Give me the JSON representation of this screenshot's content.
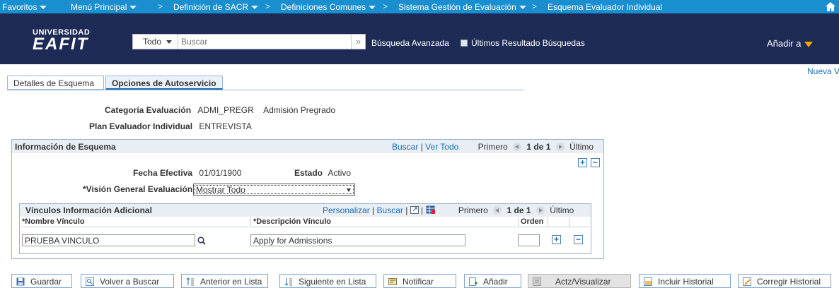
{
  "topnav": {
    "favorites": "Favoritos",
    "main_menu": "Menú Principal",
    "breadcrumbs": [
      "Definición de SACR",
      "Definiciones Comunes",
      "Sistema Gestión de Evaluación",
      "Esquema Evaluador Individual"
    ]
  },
  "header": {
    "logo_line1": "UNIVERSIDAD",
    "logo_line2": "EAFIT",
    "search_scope": "Todo",
    "search_placeholder": "Buscar",
    "advanced_search": "Búsqueda Avanzada",
    "last_results": "Últimos Resultado Búsquedas",
    "add_to": "Añadir a"
  },
  "new_window": "Nueva Ve",
  "tabs": [
    {
      "label": "Detalles de Esquema",
      "active": false
    },
    {
      "label": "Opciones de Autoservicio",
      "active": true
    }
  ],
  "fields": {
    "category_label": "Categoría Evaluación",
    "category_code": "ADMI_PREGR",
    "category_desc": "Admisión Pregrado",
    "plan_label": "Plan Evaluador Individual",
    "plan_value": "ENTREVISTA"
  },
  "schema_box": {
    "title": "Información de Esquema",
    "search_link": "Buscar",
    "sep": "|",
    "view_all_link": "Ver Todo",
    "first": "Primero",
    "range": "1 de 1",
    "last": "Último",
    "effective_date_label": "Fecha Efectiva",
    "effective_date": "01/01/1900",
    "status_label": "Estado",
    "status": "Activo",
    "overview_label": "*Visión General Evaluación",
    "overview_value": "Mostrar Todo"
  },
  "links_grid": {
    "title": "Vínculos Información Adicional",
    "personalize": "Personalizar",
    "search": "Buscar",
    "sep": "|",
    "first": "Primero",
    "range": "1 de 1",
    "last": "Último",
    "columns": [
      "*Nombre Vínculo",
      "*Descripción Vínculo",
      "Orden"
    ],
    "rows": [
      {
        "name": "PRUEBA VINCULO",
        "description": "Apply for Admissions",
        "order": ""
      }
    ]
  },
  "toolbar": [
    {
      "label": "Guardar",
      "icon": "save-icon"
    },
    {
      "label": "Volver a Buscar",
      "icon": "return-search-icon"
    },
    {
      "label": "Anterior en Lista",
      "icon": "previous-icon"
    },
    {
      "label": "Siguiente en Lista",
      "icon": "next-icon"
    },
    {
      "label": "Notificar",
      "icon": "notify-icon"
    },
    {
      "label": "Añadir",
      "icon": "add-icon"
    },
    {
      "label": "Actz/Visualizar",
      "icon": "update-display-icon",
      "disabled": true
    },
    {
      "label": "Incluir Historial",
      "icon": "include-history-icon"
    },
    {
      "label": "Corregir Historial",
      "icon": "correct-history-icon"
    }
  ],
  "colors": {
    "topnav_bg": "#1a8fd0",
    "header_bg": "#1e2b57",
    "accent_orange": "#f5a300",
    "link_blue": "#1a6fb8"
  }
}
